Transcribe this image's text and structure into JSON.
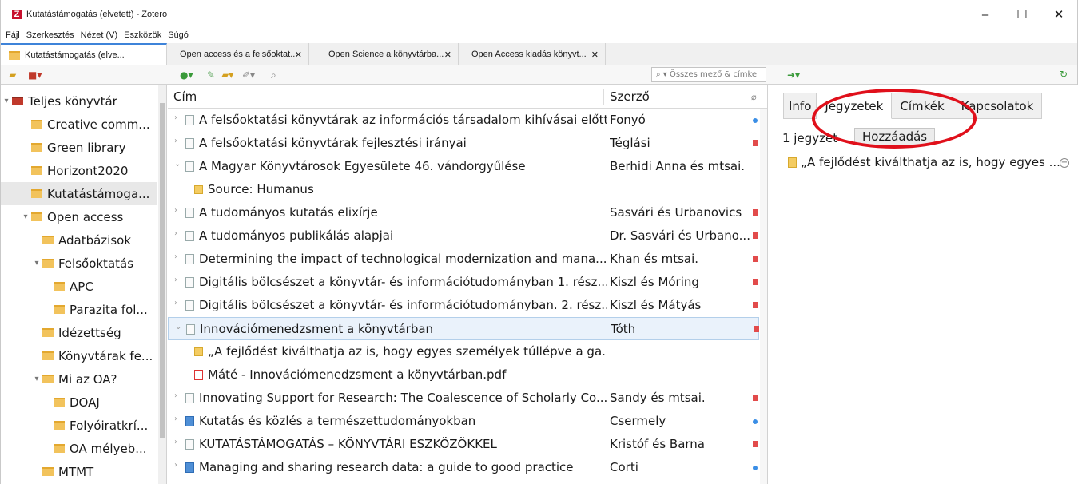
{
  "window": {
    "title": "Kutatástámogatás (elvetett) - Zotero",
    "minimize": "–",
    "maximize": "☐",
    "close": "✕"
  },
  "menu": [
    "Fájl",
    "Szerkesztés",
    "Nézet (V)",
    "Eszközök",
    "Súgó"
  ],
  "tabs": [
    {
      "label": "Kutatástámogatás (elve..."
    },
    {
      "label": "Open access és a felsőoktat...",
      "close": "✕"
    },
    {
      "label": "Open Science a könyvtárba...",
      "close": "✕"
    },
    {
      "label": "Open Access kiadás könyvt...",
      "close": "✕"
    }
  ],
  "toolbar": {
    "search_placeholder": "▾ Összes mező & címke"
  },
  "tree": {
    "items": [
      {
        "label": "Teljes könyvtár",
        "twisty": "▾"
      },
      {
        "label": "Creative comm..."
      },
      {
        "label": "Green library"
      },
      {
        "label": "Horizont2020"
      },
      {
        "label": "Kutatástámoga..."
      },
      {
        "label": "Open access",
        "twisty": "▾"
      },
      {
        "label": "Adatbázisok"
      },
      {
        "label": "Felsőoktatás",
        "twisty": "▾"
      },
      {
        "label": "APC"
      },
      {
        "label": "Parazita fol..."
      },
      {
        "label": "Idézettség"
      },
      {
        "label": "Könyvtárak fe..."
      },
      {
        "label": "Mi az OA?",
        "twisty": "▾"
      },
      {
        "label": "DOAJ"
      },
      {
        "label": "Folyóiratkrí..."
      },
      {
        "label": "OA mélyeb..."
      },
      {
        "label": "MTMT"
      }
    ]
  },
  "columns": {
    "title": "Cím",
    "author": "Szerző"
  },
  "items": [
    {
      "title": "A felsőoktatási könyvtárak az információs társadalom kihívásai előtt",
      "author": "Fonyó"
    },
    {
      "title": "A felsőoktatási könyvtárak fejlesztési irányai",
      "author": "Téglási"
    },
    {
      "title": "A Magyar Könyvtárosok Egyesülete 46. vándorgyűlése",
      "author": "Berhidi Anna és mtsai."
    },
    {
      "title": "Source: Humanus",
      "author": ""
    },
    {
      "title": "A tudományos kutatás elixírje",
      "author": "Sasvári és Urbanovics"
    },
    {
      "title": "A tudományos publikálás alapjai",
      "author": "Dr. Sasvári és Urbano..."
    },
    {
      "title": "Determining the impact of technological modernization and mana...",
      "author": "Khan és mtsai."
    },
    {
      "title": "Digitális bölcsészet a könyvtár- és információtudományban 1. rész...",
      "author": "Kiszl és Móring"
    },
    {
      "title": "Digitális bölcsészet a könyvtár- és információtudományban. 2. rész...",
      "author": "Kiszl és Mátyás"
    },
    {
      "title": "Innovációmenedzsment a könyvtárban",
      "author": "Tóth"
    },
    {
      "title": "„A fejlődést kiválthatja az is, hogy egyes személyek túllépve a ga...",
      "author": ""
    },
    {
      "title": "Máté - Innovációmenedzsment a könyvtárban.pdf",
      "author": ""
    },
    {
      "title": "Innovating Support for Research: The Coalescence of Scholarly Co...",
      "author": "Sandy és mtsai."
    },
    {
      "title": "Kutatás és közlés a természettudományokban",
      "author": "Csermely"
    },
    {
      "title": "KUTATÁSTÁMOGATÁS – KÖNYVTÁRI ESZKÖZÖKKEL",
      "author": "Kristóf és Barna"
    },
    {
      "title": "Managing and sharing research data: a guide to good practice",
      "author": "Corti"
    }
  ],
  "right_tabs": [
    "Info",
    "Jegyzetek",
    "Címkék",
    "Kapcsolatok"
  ],
  "notes": {
    "count_label": "1 jegyzet",
    "add_label": "Hozzáadás",
    "entry": "„A fejlődést kiválthatja az is, hogy egyes ...",
    "remove": "−"
  },
  "colors": {
    "accent": "#3e83d9",
    "highlight": "#e0101b"
  }
}
